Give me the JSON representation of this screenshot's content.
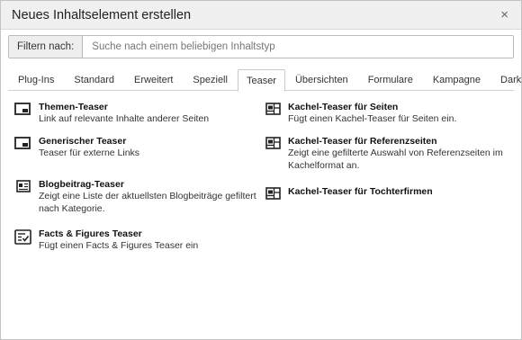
{
  "dialog": {
    "title": "Neues Inhaltselement erstellen",
    "close_symbol": "×"
  },
  "filter": {
    "label": "Filtern nach:",
    "placeholder": "Suche nach einem beliebigen Inhaltstyp",
    "value": ""
  },
  "tabs": [
    {
      "label": "Plug-Ins"
    },
    {
      "label": "Standard"
    },
    {
      "label": "Erweitert"
    },
    {
      "label": "Speziell"
    },
    {
      "label": "Teaser",
      "active": true
    },
    {
      "label": "Übersichten"
    },
    {
      "label": "Formulare"
    },
    {
      "label": "Kampagne"
    },
    {
      "label": "Dark Site"
    }
  ],
  "items_left": [
    {
      "title": "Themen-Teaser",
      "desc": "Link auf relevante Inhalte anderer Seiten",
      "icon": "image-teaser-icon"
    },
    {
      "title": "Generischer Teaser",
      "desc": "Teaser für externe Links",
      "icon": "image-teaser-icon"
    },
    {
      "title": "Blogbeitrag-Teaser",
      "desc": "Zeigt eine Liste der aktuellsten Blogbeiträge gefiltert nach Kategorie.",
      "icon": "blog-teaser-icon"
    },
    {
      "title": "Facts & Figures Teaser",
      "desc": "Fügt einen Facts & Figures Teaser ein",
      "icon": "checklist-icon"
    }
  ],
  "items_right": [
    {
      "title": "Kachel-Teaser für Seiten",
      "desc": "Fügt einen Kachel-Teaser für Seiten ein.",
      "icon": "tile-teaser-icon"
    },
    {
      "title": "Kachel-Teaser für Referenzseiten",
      "desc": "Zeigt eine gefilterte Auswahl von Referenzseiten im Kachelformat an.",
      "icon": "tile-teaser-icon"
    },
    {
      "title": "Kachel-Teaser für Tochterfirmen",
      "desc": "",
      "icon": "tile-teaser-icon"
    }
  ]
}
